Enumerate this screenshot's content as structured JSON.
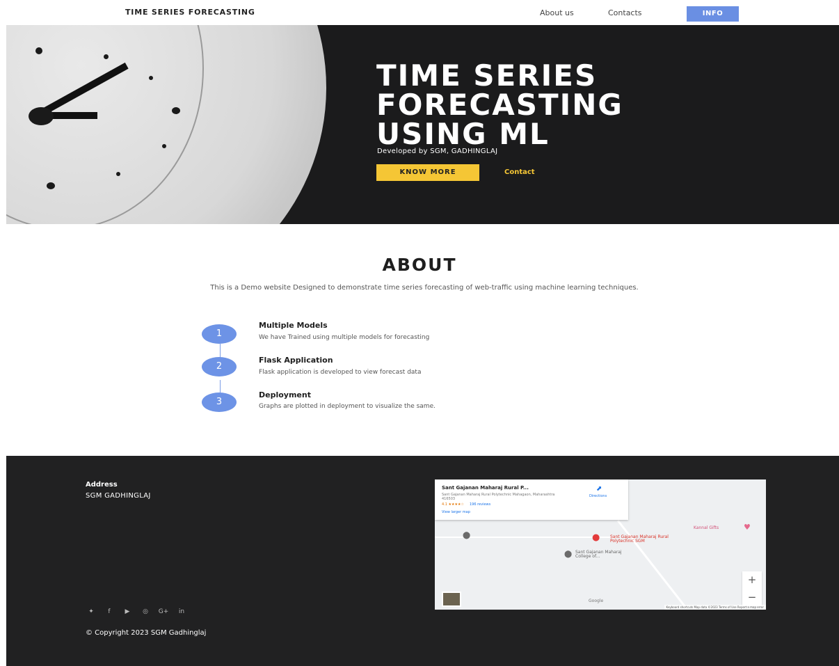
{
  "nav": {
    "brand": "TIME SERIES FORECASTING",
    "links": [
      "About us",
      "Contacts"
    ],
    "info_button": "INFO"
  },
  "hero": {
    "title_lines": [
      "TIME SERIES",
      "FORECASTING",
      "USING ML"
    ],
    "subtitle": "Developed by SGM, GADHINGLAJ",
    "primary_button": "KNOW MORE",
    "secondary_link": "Contact",
    "colors": {
      "background": "#1b1b1c",
      "accent": "#f5c635"
    }
  },
  "about": {
    "title": "ABOUT",
    "description": "This is a Demo website Designed to demonstrate time series forecasting of web-traffic using machine learning techniques.",
    "steps": [
      {
        "number": "1",
        "title": "Multiple Models",
        "description": "We have Trained using multiple models for forecasting"
      },
      {
        "number": "2",
        "title": "Flask Application",
        "description": "Flask application is developed to view forecast data"
      },
      {
        "number": "3",
        "title": "Deployment",
        "description": "Graphs are plotted in deployment  to visualize the same."
      }
    ],
    "colors": {
      "step_circle": "#6d93e6"
    }
  },
  "footer": {
    "address_label": "Address",
    "address_value": "SGM GADHINGLAJ",
    "socials": [
      "twitter-icon",
      "facebook-icon",
      "youtube-icon",
      "instagram-icon",
      "google-plus-icon",
      "linkedin-icon"
    ],
    "copyright": "© Copyright 2023 SGM Gadhinglaj",
    "map": {
      "place_title": "Sant Gajanan Maharaj Rural P...",
      "place_address": "Sant Gajanan Maharaj Rural Polytechnic Mahagaon, Maharashtra 416503",
      "rating": "4.1 ★★★★☆",
      "reviews": "196 reviews",
      "larger_map": "View larger map",
      "directions": "Directions",
      "pin_main": "Sant Gajanan Maharaj Rural Polytechnic SGM",
      "pin_college": "Sant Gajanan Maharaj College of...",
      "pin_shop": "Kannal Gifts",
      "google": "Google",
      "attribution": "Keyboard shortcuts   Map data ©2023   Terms of Use   Report a map error"
    }
  }
}
